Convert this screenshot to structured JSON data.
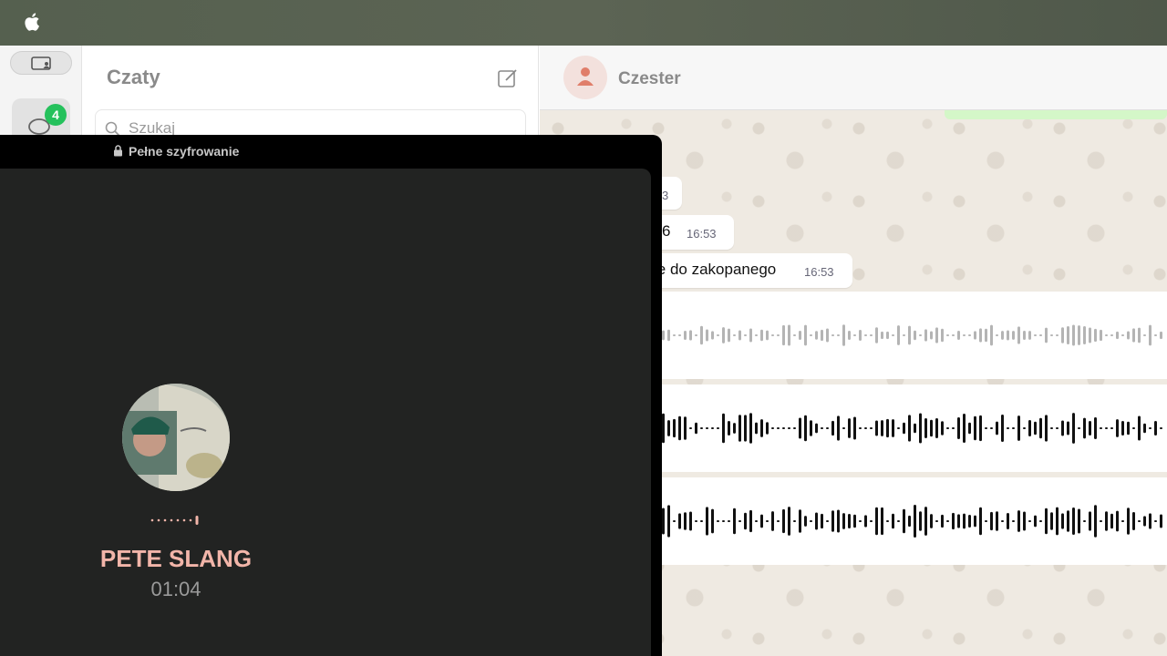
{
  "menubar": {
    "apple_icon": "apple-logo-icon"
  },
  "rail": {
    "chats_badge": "4",
    "icons": [
      "profile-card-icon",
      "chat-bubbles-icon"
    ]
  },
  "chatlist": {
    "title": "Czaty",
    "compose_icon": "compose-icon",
    "search_placeholder": "Szukaj"
  },
  "chat": {
    "contact_name": "Czester",
    "messages": [
      {
        "text": "",
        "time_partial": "3"
      },
      {
        "text": "6",
        "time": "16:53"
      },
      {
        "text": "ie do zakopanego",
        "time": "16:53"
      }
    ],
    "voice_messages": 3
  },
  "call": {
    "encryption_label": "Pełne szyfrowanie",
    "caller_name": "PETE SLANG",
    "duration": "01:04"
  },
  "colors": {
    "badge": "#25c15c",
    "caller_name": "#f2b5a9",
    "call_bg": "#222322"
  }
}
